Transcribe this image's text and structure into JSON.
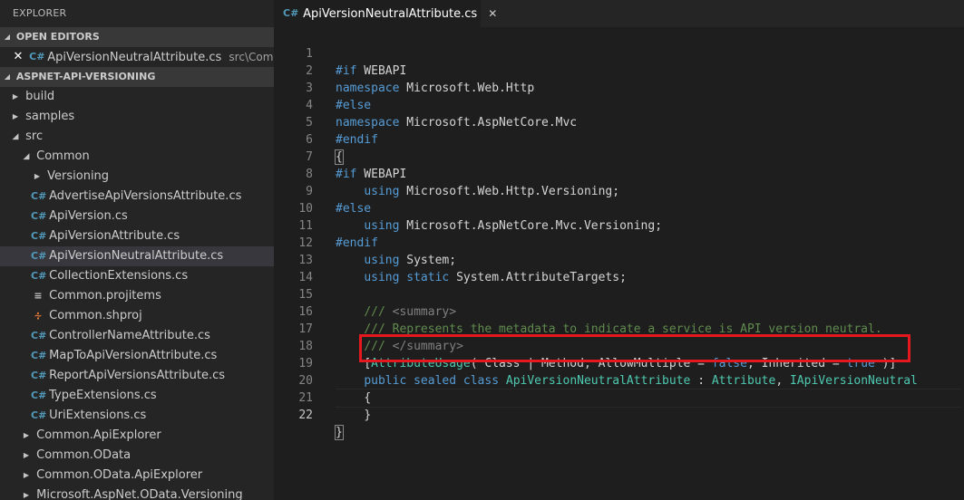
{
  "explorer": {
    "title": "EXPLORER",
    "open_editors": {
      "header": "OPEN EDITORS",
      "items": [
        {
          "name": "ApiVersionNeutralAttribute.cs",
          "path": "src\\Common"
        }
      ]
    },
    "workspace": {
      "header": "ASPNET-API-VERSIONING",
      "tree": [
        {
          "label": "build"
        },
        {
          "label": "samples"
        },
        {
          "label": "src"
        },
        {
          "label": "Common"
        },
        {
          "label": "Versioning"
        },
        {
          "label": "AdvertiseApiVersionsAttribute.cs"
        },
        {
          "label": "ApiVersion.cs"
        },
        {
          "label": "ApiVersionAttribute.cs"
        },
        {
          "label": "ApiVersionNeutralAttribute.cs"
        },
        {
          "label": "CollectionExtensions.cs"
        },
        {
          "label": "Common.projitems"
        },
        {
          "label": "Common.shproj"
        },
        {
          "label": "ControllerNameAttribute.cs"
        },
        {
          "label": "MapToApiVersionAttribute.cs"
        },
        {
          "label": "ReportApiVersionsAttribute.cs"
        },
        {
          "label": "TypeExtensions.cs"
        },
        {
          "label": "UriExtensions.cs"
        },
        {
          "label": "Common.ApiExplorer"
        },
        {
          "label": "Common.OData"
        },
        {
          "label": "Common.OData.ApiExplorer"
        },
        {
          "label": "Microsoft.AspNet.OData.Versioning"
        }
      ]
    }
  },
  "editor": {
    "tab": {
      "label": "ApiVersionNeutralAttribute.cs"
    },
    "line_numbers": [
      "1",
      "2",
      "3",
      "4",
      "5",
      "6",
      "7",
      "8",
      "9",
      "10",
      "11",
      "12",
      "13",
      "14",
      "15",
      "16",
      "17",
      "18",
      "19",
      "20",
      "21",
      "22"
    ],
    "code": {
      "l1": {
        "kw": "#if",
        "t": " WEBAPI"
      },
      "l2": {
        "kw": "namespace",
        "t": " Microsoft.Web.Http"
      },
      "l3": {
        "kw": "#else"
      },
      "l4": {
        "kw": "namespace",
        "t": " Microsoft.AspNetCore.Mvc"
      },
      "l5": {
        "kw": "#endif"
      },
      "l6": {
        "t": "{"
      },
      "l7": {
        "kw": "#if",
        "t": " WEBAPI"
      },
      "l8": {
        "kw": "using",
        "t": " Microsoft.Web.Http.Versioning;"
      },
      "l9": {
        "kw": "#else"
      },
      "l10": {
        "kw": "using",
        "t": " Microsoft.AspNetCore.Mvc.Versioning;"
      },
      "l11": {
        "kw": "#endif"
      },
      "l12": {
        "kw": "using",
        "t": " System;"
      },
      "l13": {
        "kw1": "using",
        "kw2": "static",
        "t": " System.AttributeTargets;"
      },
      "l15": {
        "c1": "/// ",
        "c2": "<summary>"
      },
      "l16": {
        "c1": "/// Represents the metadata to indicate a service is API version neutral."
      },
      "l17": {
        "c1": "/// ",
        "c2": "</summary>"
      },
      "l18": {
        "p1": "[",
        "attr": "AttributeUsage",
        "p2": "( Class | Method, AllowMultiple = ",
        "v1": "false",
        "p3": ", Inherited = ",
        "v2": "true",
        "p4": " )]"
      },
      "l19": {
        "k1": "public",
        "k2": "sealed",
        "k3": "class",
        "name": "ApiVersionNeutralAttribute",
        "p1": " : ",
        "base": "Attribute",
        "p2": ", ",
        "iface": "IApiVersionNeutral"
      },
      "l20": {
        "t": "{"
      },
      "l21": {
        "t": "}"
      },
      "l22": {
        "t": "}"
      }
    }
  },
  "colors": {
    "highlight_box": "#e5171f",
    "keyword": "#569cd6",
    "type": "#4ec9b0",
    "comment": "#608b4e"
  }
}
